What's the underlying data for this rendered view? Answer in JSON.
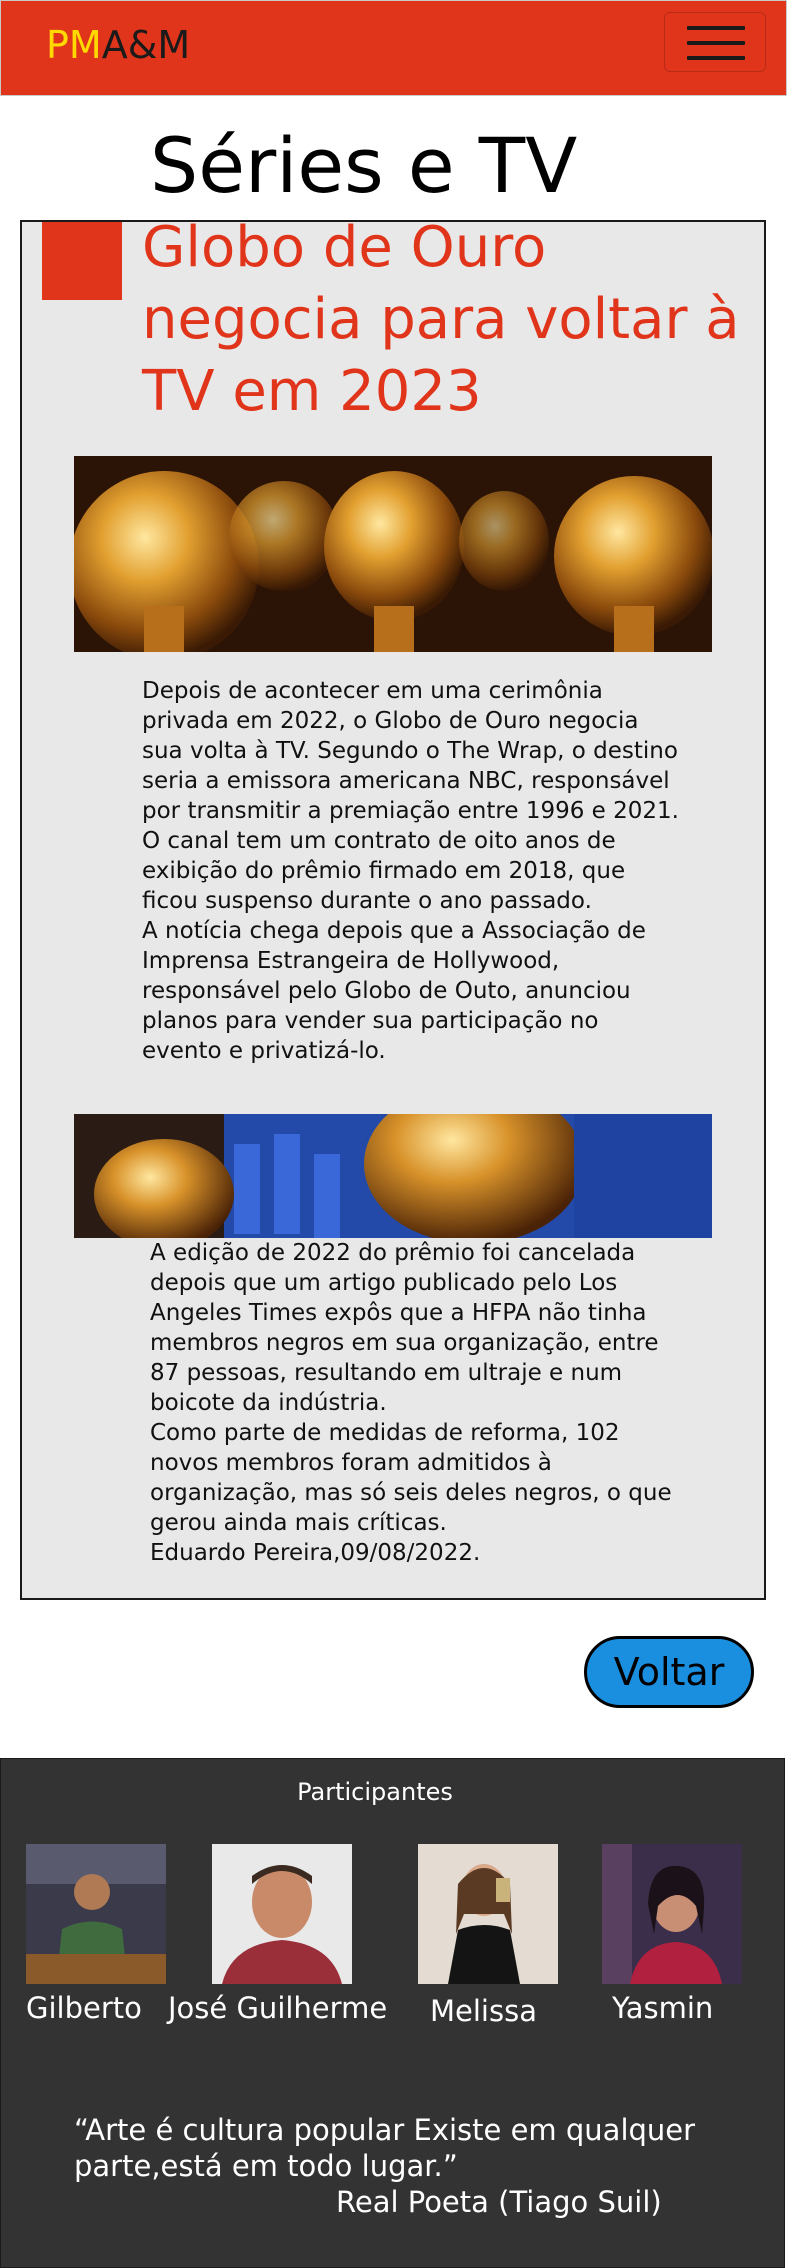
{
  "header": {
    "logo_pm": "PM",
    "logo_am": "A&M",
    "menu_icon": "hamburger-menu-icon",
    "brand_color": "#e1351b"
  },
  "page": {
    "title": "Séries e TV"
  },
  "article": {
    "headline": "Globo de Ouro negocia para voltar à TV em 2023",
    "paragraphs1": [
      "Depois de acontecer em uma cerimônia privada em 2022, o Globo de Ouro negocia sua volta à TV. Segundo o The Wrap, o destino seria a emissora americana NBC, responsável por transmitir a premiação entre 1996 e 2021.",
      "O canal tem um contrato de oito anos de exibição do prêmio firmado em 2018, que ficou suspenso durante o ano passado.",
      "A notícia chega depois que a Associação de Imprensa Estrangeira de Hollywood, responsável pelo Globo de Outo, anunciou planos para vender sua participação no evento e privatizá-lo."
    ],
    "paragraphs2": [
      "A edição de 2022 do prêmio foi cancelada depois que um artigo publicado pelo Los Angeles Times expôs que a HFPA não tinha membros negros em sua organização, entre 87 pessoas, resultando em ultraje e num boicote da indústria.",
      "Como parte de medidas de reforma, 102 novos membros foram admitidos à organização, mas só seis deles negros, o que gerou ainda mais críticas.",
      "Eduardo Pereira,09/08/2022."
    ]
  },
  "actions": {
    "back_label": "Voltar",
    "back_color": "#1a8fe0"
  },
  "footer": {
    "title": "Participantes",
    "members": [
      {
        "name": "Gilberto"
      },
      {
        "name": "José Guilherme"
      },
      {
        "name": "Melissa"
      },
      {
        "name": "Yasmin"
      }
    ],
    "quote": "“Arte é cultura popular Existe em qualquer parte,está em todo lugar.”",
    "quote_author": "Real Poeta (Tiago Suil)"
  }
}
